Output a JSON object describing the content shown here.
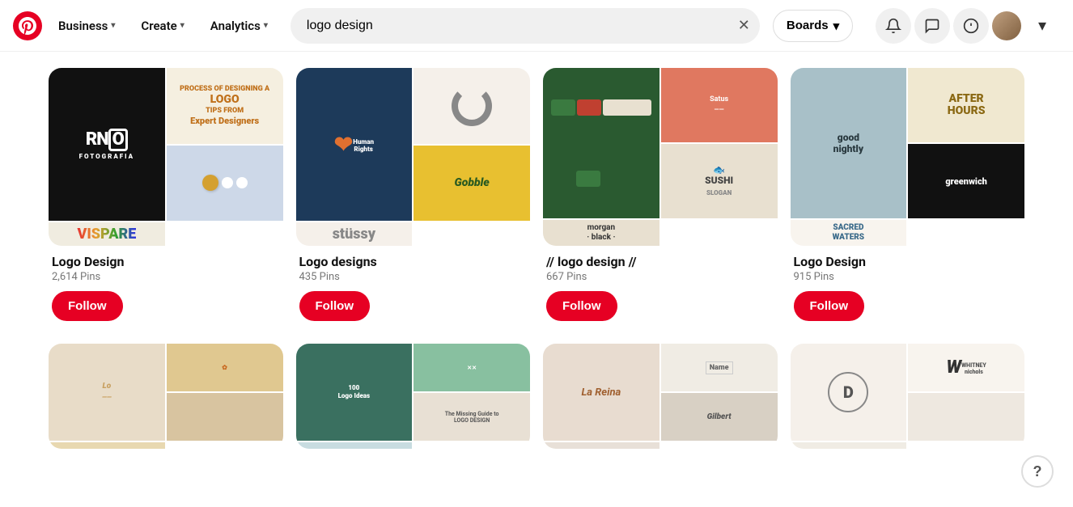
{
  "header": {
    "logo_symbol": "P",
    "business_label": "Business",
    "create_label": "Create",
    "analytics_label": "Analytics",
    "search_value": "logo design",
    "boards_label": "Boards",
    "help_label": "?"
  },
  "boards": [
    {
      "id": "board-1",
      "title": "Logo Design",
      "pins": "2,614 Pins",
      "follow_label": "Follow"
    },
    {
      "id": "board-2",
      "title": "Logo designs",
      "pins": "435 Pins",
      "follow_label": "Follow"
    },
    {
      "id": "board-3",
      "title": "// logo design //",
      "pins": "667 Pins",
      "follow_label": "Follow"
    },
    {
      "id": "board-4",
      "title": "Logo Design",
      "pins": "915 Pins",
      "follow_label": "Follow"
    }
  ],
  "boards_row2": [
    {
      "id": "board-5",
      "title": "",
      "pins": "",
      "follow_label": ""
    },
    {
      "id": "board-6",
      "title": "",
      "pins": "",
      "follow_label": ""
    },
    {
      "id": "board-7",
      "title": "",
      "pins": "",
      "follow_label": ""
    },
    {
      "id": "board-8",
      "title": "",
      "pins": "",
      "follow_label": ""
    }
  ]
}
